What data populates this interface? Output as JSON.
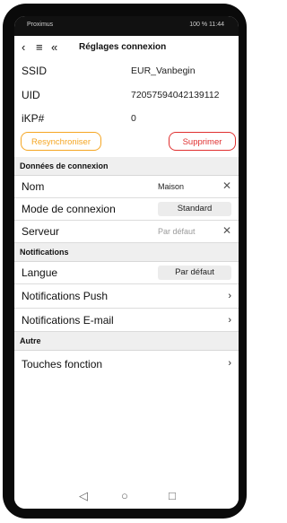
{
  "status_bar": {
    "carrier": "Proximus",
    "right": "100 % 11:44"
  },
  "header": {
    "title": "Réglages connexion",
    "back_icon": "chevron-left",
    "menu_icon": "menu-lines",
    "collapse_icon": "double-chevron-left"
  },
  "device": {
    "ssid_label": "SSID",
    "ssid_value": "EUR_Vanbegin",
    "uid_label": "UID",
    "uid_value": "72057594042139112",
    "ikp_label": "iKP#",
    "ikp_value": "0",
    "resync_label": "Resynchroniser",
    "delete_label": "Supprimer"
  },
  "connection": {
    "section_title": "Données de connexion",
    "name_label": "Nom",
    "name_value": "Maison",
    "mode_label": "Mode de connexion",
    "mode_value": "Standard",
    "server_label": "Serveur",
    "server_placeholder": "Par défaut"
  },
  "notifications": {
    "section_title": "Notifications",
    "language_label": "Langue",
    "language_value": "Par défaut",
    "push_label": "Notifications Push",
    "email_label": "Notifications E-mail"
  },
  "other": {
    "section_title": "Autre",
    "function_keys_label": "Touches fonction"
  },
  "colors": {
    "resync_accent": "#f5a623",
    "delete_accent": "#e03030"
  }
}
